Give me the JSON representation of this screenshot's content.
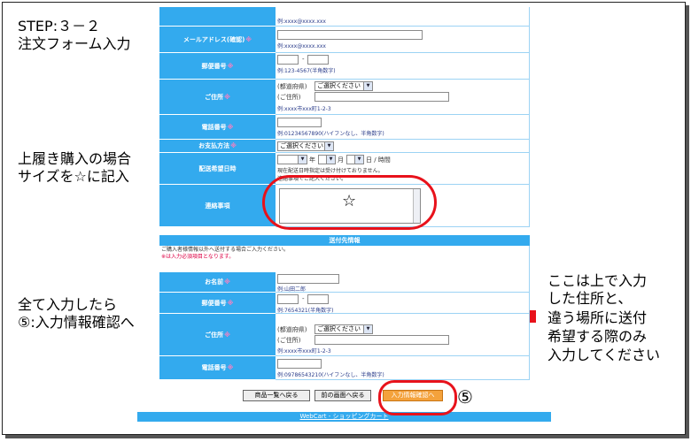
{
  "notes": {
    "step_line1": "STEP:３－２",
    "step_line2": "注文フォーム入力",
    "overwrite_line1": "上履き購入の場合",
    "overwrite_line2": "サイズを☆に記入",
    "all_line1": "全て入力したら",
    "all_line2": "⑤:入力情報確認へ",
    "right_line1": "ここは上で入力",
    "right_line2": "した住所と、",
    "right_line3": "違う場所に送付",
    "right_line4": "希望する際のみ",
    "right_line5": "入力してください",
    "circle_five": "⑤",
    "star": "☆"
  },
  "form": {
    "top_hint": "例:xxxx@xxxx.xxx",
    "email_confirm_label": "メールアドレス(確認)",
    "email_confirm_hint": "例:xxxx@xxxx.xxx",
    "postal_label": "郵便番号",
    "postal_hint": "例:123-4567(半角数字)",
    "address_label": "ご住所",
    "pref_prefix": "(都道府県)",
    "pref_select": "ご選択ください",
    "addr_prefix": "(ご住所)",
    "address_hint": "例:xxxx市xxx町1-2-3",
    "phone_label": "電話番号",
    "phone_hint": "例:01234567890(ハイフンなし、半角数字)",
    "payment_label": "お支払方法",
    "payment_select": "ご選択ください",
    "delivery_label": "配送希望日時",
    "year": "年",
    "month": "月",
    "day_time": "日 / 時間",
    "delivery_note1": "現在配送日時指定は受け付けておりません。",
    "delivery_note2": "連絡事項でご記入ください。",
    "contact_label": "連絡事項",
    "req_mark": "※",
    "dash": "-"
  },
  "shipping": {
    "section_title": "送付先情報",
    "note1": "ご購入者様情報以外へ送付する場合ご入力ください。",
    "note2": "※は入力必須項目となります。",
    "name_label": "お名前",
    "name_hint": "例:山田二郎",
    "postal_label": "郵便番号",
    "postal_hint": "例:7654321(半角数字)",
    "address_label": "ご住所",
    "pref_prefix": "(都道府県)",
    "pref_select": "ご選択ください",
    "addr_prefix": "(ご住所)",
    "address_hint": "例:xxxx市xxx町1-2-3",
    "phone_label": "電話番号",
    "phone_hint": "例:09786543210(ハイフンなし、半角数字)"
  },
  "buttons": {
    "back_to_list": "商品一覧へ戻る",
    "back_prev": "前の画面へ戻る",
    "confirm": "入力情報確認へ"
  },
  "footer": "WebCart - ショッピングカート",
  "colors": {
    "accent_blue": "#33aaee",
    "highlight_red": "#e8121b",
    "confirm_orange": "#f4a23c"
  }
}
